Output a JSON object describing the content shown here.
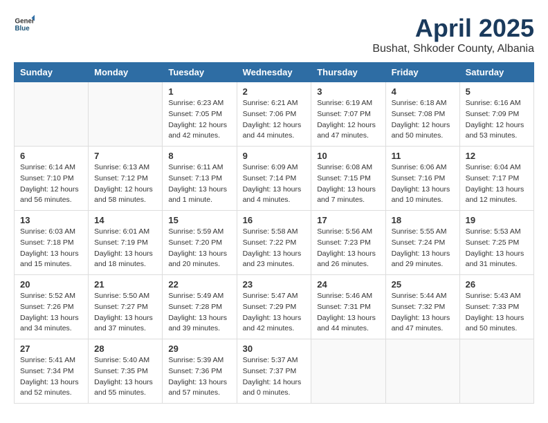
{
  "header": {
    "logo_general": "General",
    "logo_blue": "Blue",
    "month_title": "April 2025",
    "location": "Bushat, Shkoder County, Albania"
  },
  "weekdays": [
    "Sunday",
    "Monday",
    "Tuesday",
    "Wednesday",
    "Thursday",
    "Friday",
    "Saturday"
  ],
  "weeks": [
    [
      {
        "day": "",
        "info": ""
      },
      {
        "day": "",
        "info": ""
      },
      {
        "day": "1",
        "info": "Sunrise: 6:23 AM\nSunset: 7:05 PM\nDaylight: 12 hours\nand 42 minutes."
      },
      {
        "day": "2",
        "info": "Sunrise: 6:21 AM\nSunset: 7:06 PM\nDaylight: 12 hours\nand 44 minutes."
      },
      {
        "day": "3",
        "info": "Sunrise: 6:19 AM\nSunset: 7:07 PM\nDaylight: 12 hours\nand 47 minutes."
      },
      {
        "day": "4",
        "info": "Sunrise: 6:18 AM\nSunset: 7:08 PM\nDaylight: 12 hours\nand 50 minutes."
      },
      {
        "day": "5",
        "info": "Sunrise: 6:16 AM\nSunset: 7:09 PM\nDaylight: 12 hours\nand 53 minutes."
      }
    ],
    [
      {
        "day": "6",
        "info": "Sunrise: 6:14 AM\nSunset: 7:10 PM\nDaylight: 12 hours\nand 56 minutes."
      },
      {
        "day": "7",
        "info": "Sunrise: 6:13 AM\nSunset: 7:12 PM\nDaylight: 12 hours\nand 58 minutes."
      },
      {
        "day": "8",
        "info": "Sunrise: 6:11 AM\nSunset: 7:13 PM\nDaylight: 13 hours\nand 1 minute."
      },
      {
        "day": "9",
        "info": "Sunrise: 6:09 AM\nSunset: 7:14 PM\nDaylight: 13 hours\nand 4 minutes."
      },
      {
        "day": "10",
        "info": "Sunrise: 6:08 AM\nSunset: 7:15 PM\nDaylight: 13 hours\nand 7 minutes."
      },
      {
        "day": "11",
        "info": "Sunrise: 6:06 AM\nSunset: 7:16 PM\nDaylight: 13 hours\nand 10 minutes."
      },
      {
        "day": "12",
        "info": "Sunrise: 6:04 AM\nSunset: 7:17 PM\nDaylight: 13 hours\nand 12 minutes."
      }
    ],
    [
      {
        "day": "13",
        "info": "Sunrise: 6:03 AM\nSunset: 7:18 PM\nDaylight: 13 hours\nand 15 minutes."
      },
      {
        "day": "14",
        "info": "Sunrise: 6:01 AM\nSunset: 7:19 PM\nDaylight: 13 hours\nand 18 minutes."
      },
      {
        "day": "15",
        "info": "Sunrise: 5:59 AM\nSunset: 7:20 PM\nDaylight: 13 hours\nand 20 minutes."
      },
      {
        "day": "16",
        "info": "Sunrise: 5:58 AM\nSunset: 7:22 PM\nDaylight: 13 hours\nand 23 minutes."
      },
      {
        "day": "17",
        "info": "Sunrise: 5:56 AM\nSunset: 7:23 PM\nDaylight: 13 hours\nand 26 minutes."
      },
      {
        "day": "18",
        "info": "Sunrise: 5:55 AM\nSunset: 7:24 PM\nDaylight: 13 hours\nand 29 minutes."
      },
      {
        "day": "19",
        "info": "Sunrise: 5:53 AM\nSunset: 7:25 PM\nDaylight: 13 hours\nand 31 minutes."
      }
    ],
    [
      {
        "day": "20",
        "info": "Sunrise: 5:52 AM\nSunset: 7:26 PM\nDaylight: 13 hours\nand 34 minutes."
      },
      {
        "day": "21",
        "info": "Sunrise: 5:50 AM\nSunset: 7:27 PM\nDaylight: 13 hours\nand 37 minutes."
      },
      {
        "day": "22",
        "info": "Sunrise: 5:49 AM\nSunset: 7:28 PM\nDaylight: 13 hours\nand 39 minutes."
      },
      {
        "day": "23",
        "info": "Sunrise: 5:47 AM\nSunset: 7:29 PM\nDaylight: 13 hours\nand 42 minutes."
      },
      {
        "day": "24",
        "info": "Sunrise: 5:46 AM\nSunset: 7:31 PM\nDaylight: 13 hours\nand 44 minutes."
      },
      {
        "day": "25",
        "info": "Sunrise: 5:44 AM\nSunset: 7:32 PM\nDaylight: 13 hours\nand 47 minutes."
      },
      {
        "day": "26",
        "info": "Sunrise: 5:43 AM\nSunset: 7:33 PM\nDaylight: 13 hours\nand 50 minutes."
      }
    ],
    [
      {
        "day": "27",
        "info": "Sunrise: 5:41 AM\nSunset: 7:34 PM\nDaylight: 13 hours\nand 52 minutes."
      },
      {
        "day": "28",
        "info": "Sunrise: 5:40 AM\nSunset: 7:35 PM\nDaylight: 13 hours\nand 55 minutes."
      },
      {
        "day": "29",
        "info": "Sunrise: 5:39 AM\nSunset: 7:36 PM\nDaylight: 13 hours\nand 57 minutes."
      },
      {
        "day": "30",
        "info": "Sunrise: 5:37 AM\nSunset: 7:37 PM\nDaylight: 14 hours\nand 0 minutes."
      },
      {
        "day": "",
        "info": ""
      },
      {
        "day": "",
        "info": ""
      },
      {
        "day": "",
        "info": ""
      }
    ]
  ]
}
